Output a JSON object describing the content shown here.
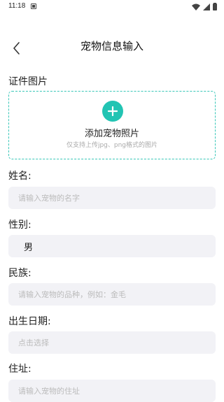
{
  "status_bar": {
    "time": "11:18"
  },
  "header": {
    "title": "宠物信息输入"
  },
  "photo": {
    "label": "证件图片",
    "upload_title": "添加宠物照片",
    "upload_hint": "仅支持上传jpg、png格式的图片"
  },
  "form": {
    "name": {
      "label": "姓名:",
      "placeholder": "请输入宠物的名字"
    },
    "gender": {
      "label": "性别:",
      "value": "男"
    },
    "ethnicity": {
      "label": "民族:",
      "placeholder": "请输入宠物的品种，例如：金毛"
    },
    "birth_date": {
      "label": "出生日期:",
      "placeholder": "点击选择"
    },
    "address": {
      "label": "住址:",
      "placeholder": "请输入宠物的住址"
    }
  },
  "colors": {
    "accent": "#22c4b3",
    "field_bg": "#f2f2f6"
  }
}
